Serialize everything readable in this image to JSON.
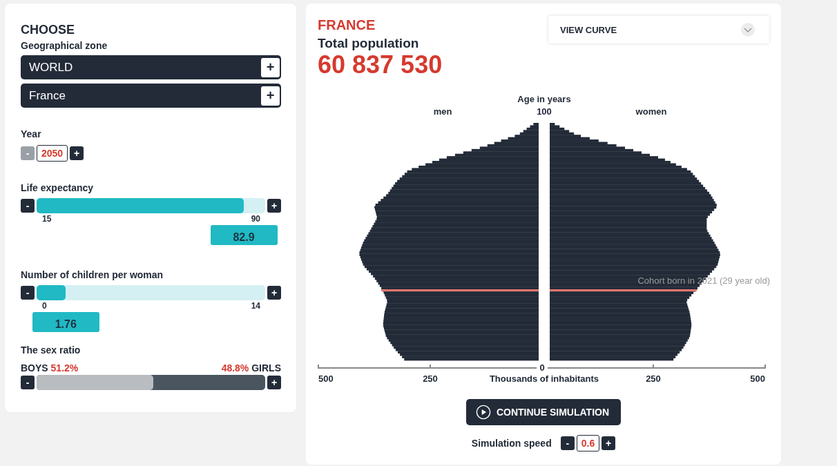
{
  "sidebar": {
    "title": "CHOOSE",
    "zone_label": "Geographical zone",
    "zones": [
      {
        "label": "WORLD",
        "button": "+"
      },
      {
        "label": "France",
        "button": "+"
      }
    ],
    "year": {
      "label": "Year",
      "minus": "-",
      "minus_disabled": true,
      "value": "2050",
      "plus": "+"
    },
    "sliders": [
      {
        "label": "Life expectancy",
        "minus": "-",
        "plus": "+",
        "level": 0.905,
        "min": "15",
        "max": "90",
        "value": "82.9"
      },
      {
        "label": "Number of children per woman",
        "minus": "-",
        "plus": "+",
        "level": 0.126,
        "min": "0",
        "max": "14",
        "value": "1.76"
      }
    ],
    "sex_ratio": {
      "label": "The sex ratio",
      "boys_label": "BOYS",
      "boys_value": "51.2%",
      "girls_value": "48.8%",
      "girls_label": "GIRLS",
      "level": 0.512,
      "minus": "-",
      "plus": "+"
    }
  },
  "main": {
    "country": "FRANCE",
    "subtitle": "Total population",
    "population": "60 837 530",
    "view_select": {
      "label": "VIEW CURVE"
    },
    "pyramid": {
      "y_title": "Age in years",
      "top_age": "100",
      "left_label": "men",
      "right_label": "women",
      "x_ticks": [
        "500",
        "250",
        "0",
        "250",
        "500"
      ],
      "x_title": "Thousands of inhabitants",
      "cohort_note": "Cohort born in 2021 (29 year old)"
    },
    "simulate_button": {
      "label": "CONTINUE SIMULATION"
    },
    "speed": {
      "label": "Simulation speed",
      "minus": "-",
      "value": "0.6",
      "plus": "+"
    }
  }
}
